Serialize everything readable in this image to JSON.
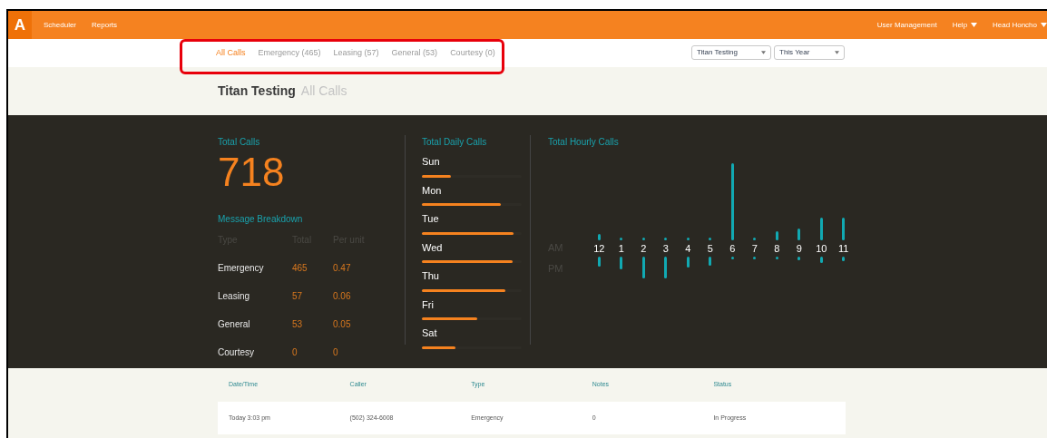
{
  "nav": {
    "logo": "A",
    "links": [
      "Scheduler",
      "Reports"
    ],
    "right": [
      {
        "label": "User Management",
        "dropdown": false
      },
      {
        "label": "Help",
        "dropdown": true
      },
      {
        "label": "Head Honcho",
        "dropdown": true
      }
    ]
  },
  "filters": [
    {
      "label": "All Calls",
      "selected": true
    },
    {
      "label": "Emergency (465)",
      "selected": false
    },
    {
      "label": "Leasing (57)",
      "selected": false
    },
    {
      "label": "General (53)",
      "selected": false
    },
    {
      "label": "Courtesy (0)",
      "selected": false
    }
  ],
  "selects": [
    {
      "value": "Titan Testing"
    },
    {
      "value": "This Year"
    }
  ],
  "heading": {
    "title": "Titan Testing",
    "subtitle": "All Calls"
  },
  "total_calls": {
    "label": "Total Calls",
    "value": "718"
  },
  "breakdown": {
    "title": "Message Breakdown",
    "columns": [
      "Type",
      "Total",
      "Per unit"
    ],
    "rows": [
      [
        "Emergency",
        "465",
        "0.47"
      ],
      [
        "Leasing",
        "57",
        "0.06"
      ],
      [
        "General",
        "53",
        "0.05"
      ],
      [
        "Courtesy",
        "0",
        "0"
      ]
    ]
  },
  "daily": {
    "title": "Total Daily Calls",
    "days": [
      {
        "label": "Sun",
        "level": 0.29
      },
      {
        "label": "Mon",
        "level": 0.79
      },
      {
        "label": "Tue",
        "level": 0.92
      },
      {
        "label": "Wed",
        "level": 0.91
      },
      {
        "label": "Thu",
        "level": 0.84
      },
      {
        "label": "Fri",
        "level": 0.55
      },
      {
        "label": "Sat",
        "level": 0.34
      }
    ]
  },
  "hourly": {
    "title": "Total Hourly Calls",
    "am_label": "AM",
    "pm_label": "PM",
    "hours": [
      "12",
      "1",
      "2",
      "3",
      "4",
      "5",
      "6",
      "7",
      "8",
      "9",
      "10",
      "11"
    ]
  },
  "table": {
    "columns": [
      "Date/Time",
      "Caller",
      "Type",
      "Notes",
      "Status"
    ],
    "rows": [
      [
        "Today 3:03 pm",
        "(502) 324-6008",
        "Emergency",
        "0",
        "In Progress"
      ]
    ]
  }
}
